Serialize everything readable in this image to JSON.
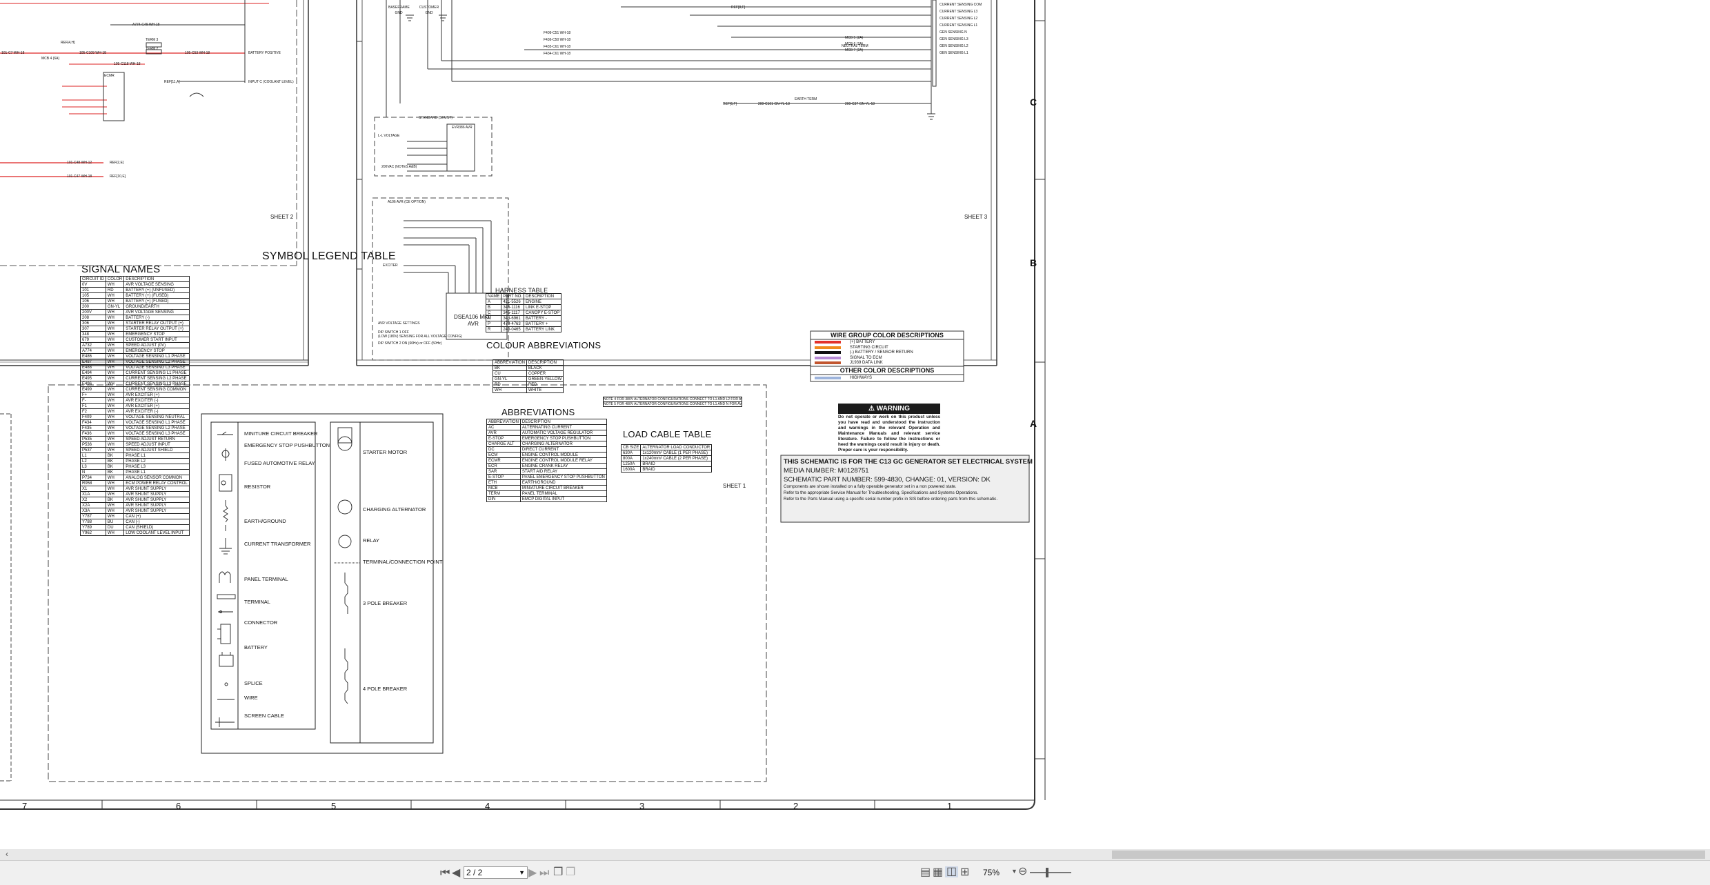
{
  "sheets": {
    "sheet1": "SHEET 1",
    "sheet2": "SHEET 2",
    "sheet3": "SHEET 3"
  },
  "zones": {
    "c": "C",
    "b": "B",
    "a": "A"
  },
  "bottom_ruler": [
    "7",
    "6",
    "5",
    "4",
    "3",
    "2",
    "1"
  ],
  "symbol_legend": {
    "title": "SYMBOL LEGEND TABLE",
    "left": [
      "MINITURE CIRCUIT BREAKER",
      "EMERGENCY STOP PUSHBUTTON",
      "FUSED AUTOMOTIVE RELAY",
      "RESISTOR",
      "EARTH/GROUND",
      "CURRENT TRANSFORMER",
      "PANEL TERMINAL",
      "TERMINAL",
      "CONNECTOR",
      "BATTERY",
      "SPLICE",
      "WIRE",
      "SCREEN CABLE"
    ],
    "right": [
      "STARTER MOTOR",
      "CHARGING ALTERNATOR",
      "RELAY",
      "TERMINAL/CONNECTION POINT",
      "3 POLE BREAKER",
      "4 POLE BREAKER"
    ]
  },
  "signal_names": {
    "title": "SIGNAL NAMES",
    "header": [
      "CIRCUIT ID",
      "COLOR",
      "DESCRIPTION"
    ],
    "rows": [
      [
        "0V",
        "WH",
        "AVR VOLTAGE SENSING"
      ],
      [
        "101",
        "RD",
        "BATTERY (+) (UNFUSED)"
      ],
      [
        "105",
        "WH",
        "BATTERY (+) (FUSED)"
      ],
      [
        "106",
        "WH",
        "BATTERY (+) (FUSED)"
      ],
      [
        "200",
        "GN-YL",
        "GROUND/EARTH"
      ],
      [
        "200V",
        "WH",
        "AVR VOLTAGE SENSING"
      ],
      [
        "208",
        "WH",
        "BATTERY (-)"
      ],
      [
        "306",
        "WH",
        "STARTER RELAY OUTPUT (+)"
      ],
      [
        "307",
        "WH",
        "STARTER RELAY OUTPUT (+)"
      ],
      [
        "348",
        "WH",
        "EMERGENCY STOP"
      ],
      [
        "679",
        "WH",
        "CUSTOMER START INPUT"
      ],
      [
        "A732",
        "WH",
        "SPEED ADJUST (0V)"
      ],
      [
        "A774",
        "WH",
        "EMERGENCY STOP"
      ],
      [
        "E486",
        "WH",
        "VOLTAGE SENSING L1 PHASE"
      ],
      [
        "E487",
        "WH",
        "VOLTAGE SENSING L2 PHASE"
      ],
      [
        "E488",
        "WH",
        "VOLTAGE SENSING L3 PHASE"
      ],
      [
        "E494",
        "WH",
        "CURRENT SENSING L1 PHASE"
      ],
      [
        "E495",
        "WH",
        "CURRENT SENSING L2 PHASE"
      ],
      [
        "E496",
        "WH",
        "CURRENT SENSING L3 PHASE"
      ],
      [
        "E499",
        "WH",
        "CURRENT SENSING COMMON"
      ],
      [
        "F+",
        "WH",
        "AVR EXCITER (+)"
      ],
      [
        "F-",
        "WH",
        "AVR EXCITER (-)"
      ],
      [
        "F1",
        "WH",
        "AVR EXCITER (+)"
      ],
      [
        "F2",
        "WH",
        "AVR EXCITER (-)"
      ],
      [
        "F409",
        "WH",
        "VOLTAGE SENSING NEUTRAL"
      ],
      [
        "F434",
        "WH",
        "VOLTAGE SENSING L1 PHASE"
      ],
      [
        "F435",
        "WH",
        "VOLTAGE SENSING L2 PHASE"
      ],
      [
        "F436",
        "WH",
        "VOLTAGE SENSING L3 PHASE"
      ],
      [
        "P535",
        "WH",
        "SPEED ADJUST RETURN"
      ],
      [
        "P536",
        "WH",
        "SPEED ADJUST INPUT"
      ],
      [
        "P537",
        "WH",
        "SPEED ADJUST SHIELD"
      ],
      [
        "L1",
        "BK",
        "PHASE L1"
      ],
      [
        "L2",
        "BK",
        "PHASE L2"
      ],
      [
        "L3",
        "BK",
        "PHASE L3"
      ],
      [
        "N",
        "BK",
        "PHASE L1"
      ],
      [
        "P734",
        "WH",
        "ANALOG SENSOR COMMON"
      ],
      [
        "R958",
        "WH",
        "ECM POWER RELAY CONTROL"
      ],
      [
        "X1",
        "WH",
        "AVR SHUNT SUPPLY"
      ],
      [
        "X1A",
        "WH",
        "AVR SHUNT SUPPLY"
      ],
      [
        "X2",
        "BK",
        "AVR SHUNT SUPPLY"
      ],
      [
        "X2A",
        "WH",
        "AVR SHUNT SUPPLY"
      ],
      [
        "X3A",
        "WH",
        "AVR SHUNT SUPPLY"
      ],
      [
        "Y787",
        "WH",
        "CAN (+)"
      ],
      [
        "Y788",
        "BU",
        "CAN (-)"
      ],
      [
        "Y789",
        "DU",
        "CAN (SHIELD)"
      ],
      [
        "Y962",
        "WH",
        "LOW COOLANT LEVEL INPUT"
      ]
    ]
  },
  "harness_table": {
    "title": "HARNESS TABLE",
    "header": [
      "NAME",
      "PART NO.",
      "DESCRIPTION"
    ],
    "rows": [
      [
        "A",
        "421-5526",
        "ENGINE"
      ],
      [
        "B",
        "345-1116",
        "LINK E-STOP"
      ],
      [
        "C",
        "345-1117",
        "CANOPY E-STOP"
      ],
      [
        "N",
        "348-6961",
        "BATTERY -"
      ],
      [
        "P",
        "479-4763",
        "BATTERY +"
      ],
      [
        "R",
        "240-0465",
        "BATTERY LINK"
      ]
    ]
  },
  "colour_abbreviations": {
    "title": "COLOUR ABBREVIATIONS",
    "header": [
      "ABBREVIATION",
      "DESCRIPTION"
    ],
    "rows": [
      [
        "BK",
        "BLACK"
      ],
      [
        "CU",
        "COPPER"
      ],
      [
        "GN-YL",
        "GREEN-YELLOW"
      ],
      [
        "RD",
        "RED"
      ],
      [
        "WH",
        "WHITE"
      ]
    ]
  },
  "abbreviations": {
    "title": "ABBREVIATIONS",
    "header": [
      "ABBREVIATION",
      "DESCRIPTION"
    ],
    "rows": [
      [
        "AC",
        "ALTERNATING CURRENT"
      ],
      [
        "AVR",
        "AUTOMATIC VOLTAGE REGULATOR"
      ],
      [
        "E-STOP",
        "EMERGENCY STOP PUSHBUTTON"
      ],
      [
        "CHARGE ALT",
        "CHARGING ALTERNATOR"
      ],
      [
        "DC",
        "DIRECT CURRENT"
      ],
      [
        "ECM",
        "ENGINE CONTROL MODULE"
      ],
      [
        "ECMR",
        "ENGINE CONTROL MODULE RELAY"
      ],
      [
        "ECR",
        "ENGINE CRANK RELAY"
      ],
      [
        "SAR",
        "START AID RELAY"
      ],
      [
        "E-STOP",
        "PANEL EMERGENCY STOP PUSHBUTTON"
      ],
      [
        "ETH",
        "EARTH/GROUND"
      ],
      [
        "MCB",
        "MINIATURE CIRCUIT BREAKER"
      ],
      [
        "TERM",
        "PANEL TERMINAL"
      ],
      [
        "DIN",
        "EMCP DIGITAL INPUT"
      ]
    ]
  },
  "load_cable_table": {
    "title": "LOAD CABLE TABLE",
    "header": [
      "CB SIZE",
      "ALTERNATOR LOAD CONDUCTOR"
    ],
    "rows": [
      [
        "630A",
        "1x120mm² CABLE (1 PER PHASE)"
      ],
      [
        "800A",
        "1x240mm² CABLE (2 PER PHASE)"
      ],
      [
        "1250A",
        "BRAID"
      ],
      [
        "1600A",
        "BRAID"
      ]
    ]
  },
  "notes": [
    "NOTE 4    FOR 380V ALTERNATOR CONFIGURATIONS CONNECT TO L1 AND L2 FOR AVR 380V SUPPLY",
    "NOTE 5    FOR 480V ALTERNATOR CONFIGURATIONS CONNECT TO L1 AND N FOR AVR 380V SUPPLY"
  ],
  "wire_group": {
    "title": "WIRE GROUP COLOR DESCRIPTIONS",
    "items": [
      {
        "label": "(+) BATTERY",
        "color": "#e3322b"
      },
      {
        "label": "STARTING CIRCUIT",
        "color": "#f08a1c"
      },
      {
        "label": "(-) BATTERY / SENSOR RETURN",
        "color": "#111111"
      },
      {
        "label": "SIGNAL TO ECM",
        "color": "#b88bd6"
      },
      {
        "label": "J1939 DATA LINK",
        "color": "#c2562f"
      }
    ],
    "other_title": "OTHER COLOR DESCRIPTIONS",
    "other_items": [
      {
        "label": "HIGHWAYS",
        "color": "#9db4dc"
      }
    ]
  },
  "warning": {
    "title": "WARNING",
    "text": "Do not operate or work on this product unless you have read and understood the instruction and warnings in the relevant Operation and Maintenance Manuals and relevant service literature. Failure to follow the instructions or heed the warnings could result in injury or death. Proper care is your responsibility."
  },
  "title_block": {
    "line1": "THIS SCHEMATIC IS FOR THE C13 GC GENERATOR SET ELECTRICAL SYSTEM",
    "line2": "MEDIA NUMBER: M0128751",
    "line3": "SCHEMATIC PART NUMBER: 599-4830, CHANGE: 01, VERSION: DK",
    "line4": "Components are shown installed on a fully operable generator set in a non powered state.",
    "line5": "Refer to the appropriate Service Manual for Troubleshooting, Specifications and Systems Operations.",
    "line6": "Refer to the Parts Manual using a specific serial number prefix in SIS before ordering parts from this schematic."
  },
  "sheet2_labels": {
    "term3": "TERM 3",
    "term2": "TERM 2",
    "battery_positive": "BATTERY POSITIVE",
    "mcb4": "MCB 4 (6A)",
    "input_coolant": "INPUT C (COOLANT LEVEL)",
    "w1": "101-C7 WH-18",
    "w2": "105-C109 WH-18",
    "w3": "105-C53 WH-18",
    "w4": "105-C118 WH-18",
    "w5": "A774-C49 WH-18",
    "w6": "101-C48 WH-12",
    "w7": "101-C47 WH-18",
    "ref1": "REF[2,E]",
    "ref2": "REF[10,E]",
    "ref3": "REF[4,H]",
    "ref4": "REF[11,A]",
    "relay": "ECMR"
  },
  "sheet3_labels": {
    "baseframe": "BASEFRAME GND",
    "customer": "CUSTOMER GND",
    "neutral": "NEUTRAL TERM",
    "earth": "EARTH TERM",
    "standard": "STANDARD (SHUNT)",
    "evr": "EVR386 AVR",
    "optional": "A106 AVR (CE OPTION)",
    "dsea": "DSEA106 MKII",
    "avr": "AVR",
    "settings": "AVR VOLTAGE SETTINGS",
    "dip1": "DIP SWITCH 1 OFF",
    "dip1b": "(LOW (180V) SENSING FOR ALL VOLTAGE CONFIG)",
    "dip2": "DIP SWITCH 2 ON (60Hz) or OFF (50Hz)",
    "cs": [
      "CURRENT SENSING COM",
      "CURRENT SENSING L3",
      "CURRENT SENSING L2",
      "CURRENT SENSING L1",
      "GEN SENSING N",
      "GEN SENSING L3",
      "GEN SENSING L2",
      "GEN SENSING L1"
    ],
    "mcb": [
      "MCB 5 (2A)",
      "MCB 6 (2A)",
      "MCB 7 (2A)"
    ],
    "wires": [
      "F409-C51 WH-18",
      "F436-C50 WH-18",
      "F435-C61 WH-18",
      "F434-C61 WH-18"
    ],
    "exciter": "EXCITER",
    "voltage": "L-L VOLTAGE",
    "v200": "200VAC (NOTES A&B)",
    "ref5": "REF[6,F]",
    "ref6": "REF[8,F]",
    "earth_w1": "200-C101 GN-YL-18",
    "earth_w2": "200-C37 GN-YL-18"
  },
  "statusbar": {
    "page": "2 / 2",
    "zoom": "75%"
  }
}
